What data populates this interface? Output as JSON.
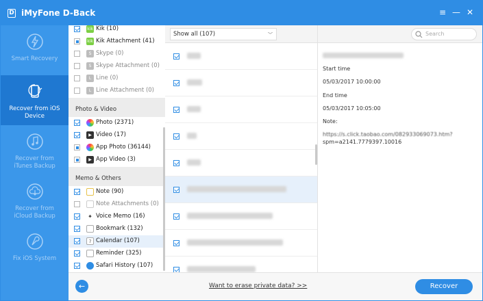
{
  "app": {
    "title": "iMyFone D-Back",
    "logo_letter": "D"
  },
  "window_controls": {
    "menu": "≡",
    "minimize": "—",
    "close": "✕"
  },
  "sidebar": {
    "items": [
      {
        "label": "Smart Recovery",
        "active": false,
        "icon": "lightning-icon"
      },
      {
        "label": "Recover from iOS Device",
        "active": true,
        "icon": "device-recover-icon"
      },
      {
        "label": "Recover from iTunes Backup",
        "active": false,
        "icon": "music-recover-icon"
      },
      {
        "label": "Recover from iCloud Backup",
        "active": false,
        "icon": "cloud-download-icon"
      },
      {
        "label": "Fix iOS System",
        "active": false,
        "icon": "wrench-icon"
      }
    ]
  },
  "categories": {
    "top_rows": [
      {
        "label": "Kik (10)",
        "check": "on",
        "icon": "kik-icon",
        "dim": false
      },
      {
        "label": "Kik Attachment (41)",
        "check": "part",
        "icon": "kik-icon",
        "dim": false
      },
      {
        "label": "Skype (0)",
        "check": "off",
        "icon": "skype-icon",
        "dim": true
      },
      {
        "label": "Skype Attachment (0)",
        "check": "off",
        "icon": "skype-icon",
        "dim": true
      },
      {
        "label": "Line (0)",
        "check": "off",
        "icon": "line-icon",
        "dim": true
      },
      {
        "label": "Line Attachment (0)",
        "check": "off",
        "icon": "line-icon",
        "dim": true
      }
    ],
    "section_photo": "Photo & Video",
    "photo_rows": [
      {
        "label": "Photo (2371)",
        "check": "on",
        "icon": "photo-icon",
        "dim": false
      },
      {
        "label": "Video (17)",
        "check": "on",
        "icon": "video-icon",
        "dim": false
      },
      {
        "label": "App Photo (36144)",
        "check": "part",
        "icon": "photo-icon",
        "dim": false
      },
      {
        "label": "App Video (3)",
        "check": "part",
        "icon": "video-icon",
        "dim": false
      }
    ],
    "section_memo": "Memo & Others",
    "memo_rows": [
      {
        "label": "Note (90)",
        "check": "on",
        "icon": "note-icon",
        "dim": false
      },
      {
        "label": "Note Attachments (0)",
        "check": "off",
        "icon": "note-icon",
        "dim": true
      },
      {
        "label": "Voice Memo (16)",
        "check": "on",
        "icon": "voice-memo-icon",
        "dim": false
      },
      {
        "label": "Bookmark (132)",
        "check": "on",
        "icon": "bookmark-icon",
        "dim": false
      },
      {
        "label": "Calendar (107)",
        "check": "on",
        "icon": "calendar-icon",
        "dim": false,
        "highlighted": true
      },
      {
        "label": "Reminder (325)",
        "check": "on",
        "icon": "reminder-icon",
        "dim": false
      },
      {
        "label": "Safari History (107)",
        "check": "on",
        "icon": "safari-icon",
        "dim": false
      }
    ]
  },
  "list": {
    "filter": "Show all (107)",
    "selected_index": 5,
    "row_count": 9
  },
  "search": {
    "placeholder": "Search"
  },
  "detail": {
    "start_time_label": "Start time",
    "start_time": "05/03/2017 10:00:00",
    "end_time_label": "End time",
    "end_time": "05/03/2017 10:05:00",
    "note_label": "Note:",
    "note_url_line1": "https://s.click.taobao.com/082933069073.htm?",
    "note_url_line2": "spm=a2141.7779397.10016"
  },
  "footer": {
    "back": "←",
    "erase_link": "Want to erase private data? >>",
    "recover_button": "Recover"
  },
  "colors": {
    "accent": "#2f8de4",
    "sidebar_bg": "#3b97ea",
    "sidebar_active": "#1f78d1"
  }
}
